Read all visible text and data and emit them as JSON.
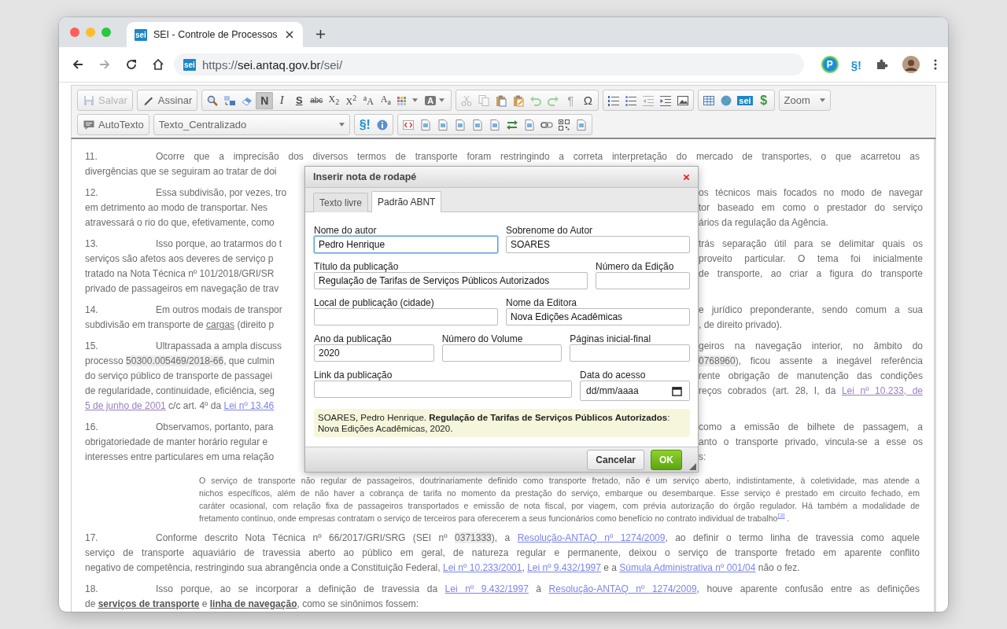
{
  "browser": {
    "tab": {
      "favicon": "sei",
      "title": "SEI - Controle de Processos"
    },
    "url": {
      "favicon": "sei",
      "scheme": "https://",
      "host": "sei.antaq.gov.br",
      "path": "/sei/"
    },
    "extensions": [
      {
        "kind": "badge",
        "label": "P"
      },
      {
        "kind": "mark",
        "label": "§!"
      },
      {
        "kind": "puzzle"
      },
      {
        "kind": "avatar"
      }
    ]
  },
  "toolbar": {
    "rows": [
      [
        [
          {
            "kind": "save",
            "label": "Salvar",
            "disabled": true,
            "pressed": false
          }
        ],
        [
          {
            "kind": "sign",
            "label": "Assinar",
            "disabled": false,
            "pressed": false
          }
        ],
        [
          {
            "kind": "find",
            "disabled": false,
            "pressed": false
          },
          {
            "kind": "replace",
            "disabled": false,
            "pressed": false
          },
          {
            "kind": "eraser",
            "disabled": false,
            "pressed": false
          },
          {
            "kind": "bold",
            "label": "N",
            "disabled": false,
            "pressed": true
          },
          {
            "kind": "italic",
            "label": "I",
            "disabled": false,
            "pressed": false
          },
          {
            "kind": "underline",
            "label": "S",
            "disabled": false,
            "pressed": false
          },
          {
            "kind": "strike",
            "label": "abc",
            "disabled": false,
            "pressed": false
          },
          {
            "kind": "script",
            "label": "X$_{2}$",
            "disabled": false,
            "pressed": false
          },
          {
            "kind": "script",
            "label": "X$^{2}$",
            "disabled": false,
            "pressed": false
          },
          {
            "kind": "case",
            "label": "$^{a}$A",
            "disabled": false,
            "pressed": false
          },
          {
            "kind": "case",
            "label": "A$_{a}$",
            "disabled": false,
            "pressed": false
          },
          {
            "kind": "palette",
            "disabled": false,
            "pressed": false
          },
          {
            "kind": "fontcolor",
            "label": "A",
            "disabled": false,
            "pressed": false
          }
        ],
        [
          {
            "kind": "cut",
            "disabled": true,
            "pressed": false
          },
          {
            "kind": "copy",
            "disabled": true,
            "pressed": false
          },
          {
            "kind": "paste",
            "disabled": false,
            "pressed": false
          },
          {
            "kind": "pasteword",
            "disabled": false,
            "pressed": false
          },
          {
            "kind": "undo",
            "disabled": true,
            "pressed": false
          },
          {
            "kind": "redo",
            "disabled": true,
            "pressed": false
          },
          {
            "kind": "glyph",
            "label": "¶",
            "disabled": true,
            "pressed": false
          },
          {
            "kind": "glyph",
            "label": "Ω",
            "disabled": false,
            "pressed": false
          }
        ],
        [
          {
            "kind": "numlist",
            "disabled": false,
            "pressed": false
          },
          {
            "kind": "bullist",
            "disabled": false,
            "pressed": false
          },
          {
            "kind": "outdent",
            "disabled": true,
            "pressed": false
          },
          {
            "kind": "indent",
            "disabled": false,
            "pressed": false
          },
          {
            "kind": "image",
            "disabled": false,
            "pressed": false
          }
        ],
        [
          {
            "kind": "table",
            "disabled": false,
            "pressed": false
          },
          {
            "kind": "globe",
            "disabled": false,
            "pressed": false
          },
          {
            "kind": "logo",
            "label": "sei",
            "disabled": false,
            "pressed": false
          },
          {
            "kind": "money",
            "label": "$",
            "disabled": false,
            "pressed": false
          }
        ],
        [
          {
            "kind": "zoom",
            "label": "Zoom",
            "disabled": false,
            "pressed": false
          }
        ]
      ],
      [
        [
          {
            "kind": "autotext",
            "label": "AutoTexto",
            "disabled": false,
            "pressed": false
          }
        ],
        [
          {
            "kind": "select",
            "label": "Texto_Centralizado",
            "disabled": false,
            "pressed": false
          }
        ],
        [
          {
            "kind": "section",
            "label": "§!",
            "disabled": false,
            "pressed": false
          },
          {
            "kind": "info",
            "disabled": false,
            "pressed": false
          }
        ],
        [
          {
            "kind": "code",
            "disabled": false,
            "pressed": false
          },
          {
            "kind": "doc",
            "disabled": false,
            "pressed": false
          },
          {
            "kind": "doc",
            "disabled": false,
            "pressed": false
          },
          {
            "kind": "doc",
            "disabled": false,
            "pressed": false
          },
          {
            "kind": "doc",
            "disabled": false,
            "pressed": false
          },
          {
            "kind": "doc",
            "disabled": false,
            "pressed": false
          },
          {
            "kind": "arrows",
            "disabled": false,
            "pressed": false
          },
          {
            "kind": "doc",
            "disabled": false,
            "pressed": false
          },
          {
            "kind": "chain",
            "disabled": false,
            "pressed": false
          },
          {
            "kind": "qr",
            "disabled": false,
            "pressed": false
          },
          {
            "kind": "doc",
            "disabled": false,
            "pressed": false
          }
        ]
      ]
    ]
  },
  "document": {
    "paragraphs": [
      {
        "kind": "numbered",
        "number": "11.",
        "lines": [
          {
            "full": [
              "Ocorre que a imprecisão dos diversos termos de transporte foram restringindo a correta interpretação do mercado de transportes, o que acarretou as"
            ]
          },
          {
            "left": [
              "divergências que se seguiram ao tratar de doi"
            ]
          }
        ]
      },
      {
        "kind": "numbered",
        "number": "12.",
        "lines": [
          {
            "left": [
              "Essa subdivisão, por vezes, tro"
            ],
            "right": [
              "os técnicos mais focados no modo de navegar"
            ]
          },
          {
            "left": [
              "em detrimento ao modo de transportar. Nes"
            ],
            "right": [
              "tor baseado em como o prestador do serviço"
            ]
          },
          {
            "left": [
              "atravessará o rio do que, efetivamente, como"
            ],
            "right": [
              "ários da regulação da Agência."
            ]
          }
        ]
      },
      {
        "kind": "numbered",
        "number": "13.",
        "lines": [
          {
            "left": [
              "Isso porque, ao tratarmos do t"
            ],
            "right": [
              "trás separação útil para se delimitar quais os"
            ]
          },
          {
            "left": [
              "serviços são afetos aos deveres de serviço p"
            ],
            "right": [
              "proveito particular. O tema foi inicialmente"
            ]
          },
          {
            "left": [
              "tratado na Nota Técnica nº 101/2018/GRI/SR"
            ],
            "right": [
              "de transporte, ao criar a figura do transporte"
            ]
          },
          {
            "left": [
              "privado de passageiros em navegação de trav"
            ]
          }
        ]
      },
      {
        "kind": "numbered",
        "number": "14.",
        "lines": [
          {
            "left": [
              "Em outros modais de transpor"
            ],
            "right": [
              "e jurídico preponderante, sendo comum a sua"
            ]
          },
          {
            "left": [
              "subdivisão em transporte de ",
              {
                "kind": "underline",
                "text": "cargas"
              },
              " (direito p"
            ],
            "right": [
              ", de direito privado)."
            ]
          }
        ]
      },
      {
        "kind": "numbered",
        "number": "15.",
        "lines": [
          {
            "left": [
              "Ultrapassada a ampla discuss"
            ],
            "right": [
              "geiros na navegação interior, no âmbito do"
            ]
          },
          {
            "left": [
              "processo ",
              {
                "kind": "code",
                "text": "50300.005469/2018-66"
              },
              ", que culmin"
            ],
            "right": [
              {
                "kind": "code",
                "text": "0768960"
              },
              "), ficou assente a inegável referência"
            ]
          },
          {
            "left": [
              "do serviço público de transporte de passagei"
            ],
            "right": [
              "rente obrigação de manutenção das condições"
            ]
          },
          {
            "left": [
              "de regularidade, continuidade, eficiência, seg"
            ],
            "right": [
              "reços cobrados (art. 28, I, da ",
              {
                "kind": "visited",
                "text": "Lei nº 10.233, de"
              }
            ]
          },
          {
            "left": [
              {
                "kind": "visited",
                "text": "5 de junho de 2001"
              },
              " c/c art. 4º da ",
              {
                "kind": "link",
                "text": "Lei nº 13.46"
              }
            ]
          }
        ]
      },
      {
        "kind": "numbered",
        "number": "16.",
        "lines": [
          {
            "left": [
              "Observamos, portanto, para"
            ],
            "right": [
              "como a emissão de bilhete de passagem, a"
            ]
          },
          {
            "left": [
              "obrigatoriedade de manter horário regular e"
            ],
            "right": [
              "anto o transporte privado, vincula-se a esse os"
            ]
          },
          {
            "left": [
              "interesses entre particulares em uma relação"
            ],
            "right": [
              "s:"
            ]
          }
        ]
      },
      {
        "kind": "quote",
        "lines": [
          {
            "full": [
              "O serviço de transporte não regular de passageiros, doutrinariamente definido como transporte fretado, não é um serviço aberto, indistintamente, à coletividade, mas atende a"
            ]
          },
          {
            "full": [
              "nichos específicos, além de não haver a cobrança de tarifa no momento da prestação do serviço, embarque ou desembarque. Esse serviço é prestado em circuito fechado, em"
            ]
          },
          {
            "full": [
              "caráter ocasional, com relação fixa de passageiros transportados e emissão de nota fiscal, por viagem, com prévia autorização do órgão regulador. Há também a modalidade de"
            ]
          },
          {
            "full": [
              "fretamento contínuo, onde empresas contratam o serviço de terceiros para oferecerem a seus funcionários como benefício no contrato individual de trabalho",
              {
                "kind": "note",
                "text": "[3]"
              },
              " ."
            ]
          }
        ]
      },
      {
        "kind": "numbered",
        "number": "17.",
        "lines": [
          {
            "full": [
              "Conforme descrito Nota Técnica nº 66/2017/GRI/SRG (SEI nº ",
              {
                "kind": "code",
                "text": "0371333"
              },
              "), a ",
              {
                "kind": "link",
                "text": "Resolução-ANTAQ nº 1274/2009"
              },
              ", ao definir o termo linha de travessia como aquele"
            ]
          },
          {
            "full": [
              "serviço de transporte aquaviário de travessia aberto ao público em geral, de natureza regular e permanente, deixou o serviço de transporte fretado em aparente conflito"
            ]
          },
          {
            "full": [
              "negativo de competência, restringindo sua abrangência onde a Constituição Federal, ",
              {
                "kind": "link",
                "text": "Lei nº 10.233/2001"
              },
              ", ",
              {
                "kind": "link",
                "text": "Lei nº 9.432/1997"
              },
              " e a ",
              {
                "kind": "link",
                "text": "Súmula Administrativa nº 001/04"
              },
              " não o fez."
            ]
          }
        ]
      },
      {
        "kind": "numbered",
        "number": "18.",
        "lines": [
          {
            "full": [
              "Isso porque, ao se incorporar a definição de travessia da ",
              {
                "kind": "link",
                "text": "Lei nº 9.432/1997"
              },
              " à ",
              {
                "kind": "link",
                "text": "Resolução-ANTAQ nº 1274/2009"
              },
              ", houve aparente confusão entre as definições"
            ]
          },
          {
            "full": [
              "de ",
              {
                "kind": "strong",
                "text": "serviços de transporte"
              },
              " e ",
              {
                "kind": "strong",
                "text": "linha de navegação"
              },
              ", como se sinônimos fossem:"
            ]
          }
        ]
      }
    ]
  },
  "dialog": {
    "title": "Inserir nota de rodapé",
    "tabs": [
      {
        "label": "Texto livre",
        "selected": false
      },
      {
        "label": "Padrão ABNT",
        "selected": true
      }
    ],
    "rows": [
      [
        {
          "kind": "text",
          "label": "Nome do autor",
          "value": "Pedro Henrique",
          "focused": true
        },
        {
          "kind": "text",
          "label": "Sobrenome do Autor",
          "value": "SOARES",
          "focused": false
        }
      ],
      [
        {
          "kind": "text",
          "label": "Título da publicação",
          "value": "Regulação de Tarifas de Serviços Públicos Autorizados",
          "focused": false
        },
        {
          "kind": "number",
          "label": "Número da Edição",
          "focused": false
        }
      ],
      [
        {
          "kind": "text",
          "label": "Local de publicação (cidade)",
          "focused": false
        },
        {
          "kind": "text",
          "label": "Nome da Editora",
          "value": "Nova Edições Acadêmicas",
          "focused": false
        }
      ],
      [
        {
          "kind": "number",
          "label": "Ano da publicação",
          "value": "2020",
          "focused": false
        },
        {
          "kind": "number",
          "label": "Número do Volume",
          "focused": false
        },
        {
          "kind": "text",
          "label": "Páginas inicial-final",
          "focused": false
        }
      ],
      [
        {
          "kind": "text",
          "label": "Link da publicação",
          "focused": false
        },
        {
          "kind": "date",
          "label": "Data do acesso",
          "placeholder": "dd/mm/aaaa",
          "focused": false
        }
      ]
    ],
    "preview": "SOARES, Pedro Henrique. **Regulação de Tarifas de Serviços Públicos Autorizados**: Nova Edições Acadêmicas, 2020.",
    "buttons": [
      {
        "kind": "secondary",
        "label": "Cancelar"
      },
      {
        "kind": "primary",
        "label": "OK"
      }
    ]
  }
}
